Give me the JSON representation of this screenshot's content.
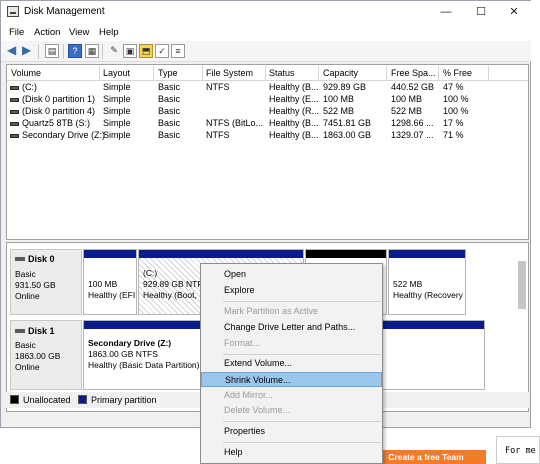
{
  "window": {
    "title": "Disk Management",
    "minimize": "—",
    "maximize": "☐",
    "close": "✕"
  },
  "menubar": [
    "File",
    "Action",
    "View",
    "Help"
  ],
  "volume_list": {
    "columns": [
      "Volume",
      "Layout",
      "Type",
      "File System",
      "Status",
      "Capacity",
      "Free Spa...",
      "% Free"
    ],
    "rows": [
      [
        "(C:)",
        "Simple",
        "Basic",
        "NTFS",
        "Healthy (B...",
        "929.89 GB",
        "440.52 GB",
        "47 %"
      ],
      [
        "(Disk 0 partition 1)",
        "Simple",
        "Basic",
        "",
        "Healthy (E...",
        "100 MB",
        "100 MB",
        "100 %"
      ],
      [
        "(Disk 0 partition 4)",
        "Simple",
        "Basic",
        "",
        "Healthy (R...",
        "522 MB",
        "522 MB",
        "100 %"
      ],
      [
        "Quartz5 8TB (S:)",
        "Simple",
        "Basic",
        "NTFS (BitLo...",
        "Healthy (B...",
        "7451.81 GB",
        "1298.66 ...",
        "17 %"
      ],
      [
        "Secondary Drive (Z:)",
        "Simple",
        "Basic",
        "NTFS",
        "Healthy (B...",
        "1863.00 GB",
        "1329.07 ...",
        "71 %"
      ]
    ]
  },
  "disks": [
    {
      "name": "Disk 0",
      "type": "Basic",
      "size": "931.50 GB",
      "state": "Online",
      "partitions": [
        {
          "line1": "100 MB",
          "line2": "Healthy (EFI"
        },
        {
          "line1": "(C:)",
          "line2": "929.89 GB NTFS",
          "line3": "Healthy (Boot,"
        },
        {
          "line1": "",
          "line2": ""
        },
        {
          "line1": "522 MB",
          "line2": "Healthy (Recovery"
        }
      ]
    },
    {
      "name": "Disk 1",
      "type": "Basic",
      "size": "1863.00 GB",
      "state": "Online",
      "partitions": [
        {
          "line1": "Secondary Drive  (Z:)",
          "line2": "1863.00 GB NTFS",
          "line3": "Healthy (Basic Data Partition)"
        }
      ]
    }
  ],
  "legend": {
    "unallocated": "Unallocated",
    "primary": "Primary partition"
  },
  "context_menu": {
    "items": [
      {
        "label": "Open",
        "enabled": true
      },
      {
        "label": "Explore",
        "enabled": true
      },
      {
        "label": "Mark Partition as Active",
        "enabled": false
      },
      {
        "label": "Change Drive Letter and Paths...",
        "enabled": true
      },
      {
        "label": "Format...",
        "enabled": false
      },
      {
        "label": "Extend Volume...",
        "enabled": true
      },
      {
        "label": "Shrink Volume...",
        "enabled": true,
        "highlighted": true
      },
      {
        "label": "Add Mirror...",
        "enabled": false
      },
      {
        "label": "Delete Volume...",
        "enabled": false
      },
      {
        "label": "Properties",
        "enabled": true
      },
      {
        "label": "Help",
        "enabled": true
      }
    ]
  },
  "background": {
    "button": "Create a free Team",
    "panel_text": "For me"
  },
  "colors": {
    "primary_partition": "#0a1c8c",
    "unallocated": "#000000",
    "menu_highlight": "#9dc6ec",
    "orange_button": "#f47c28"
  }
}
